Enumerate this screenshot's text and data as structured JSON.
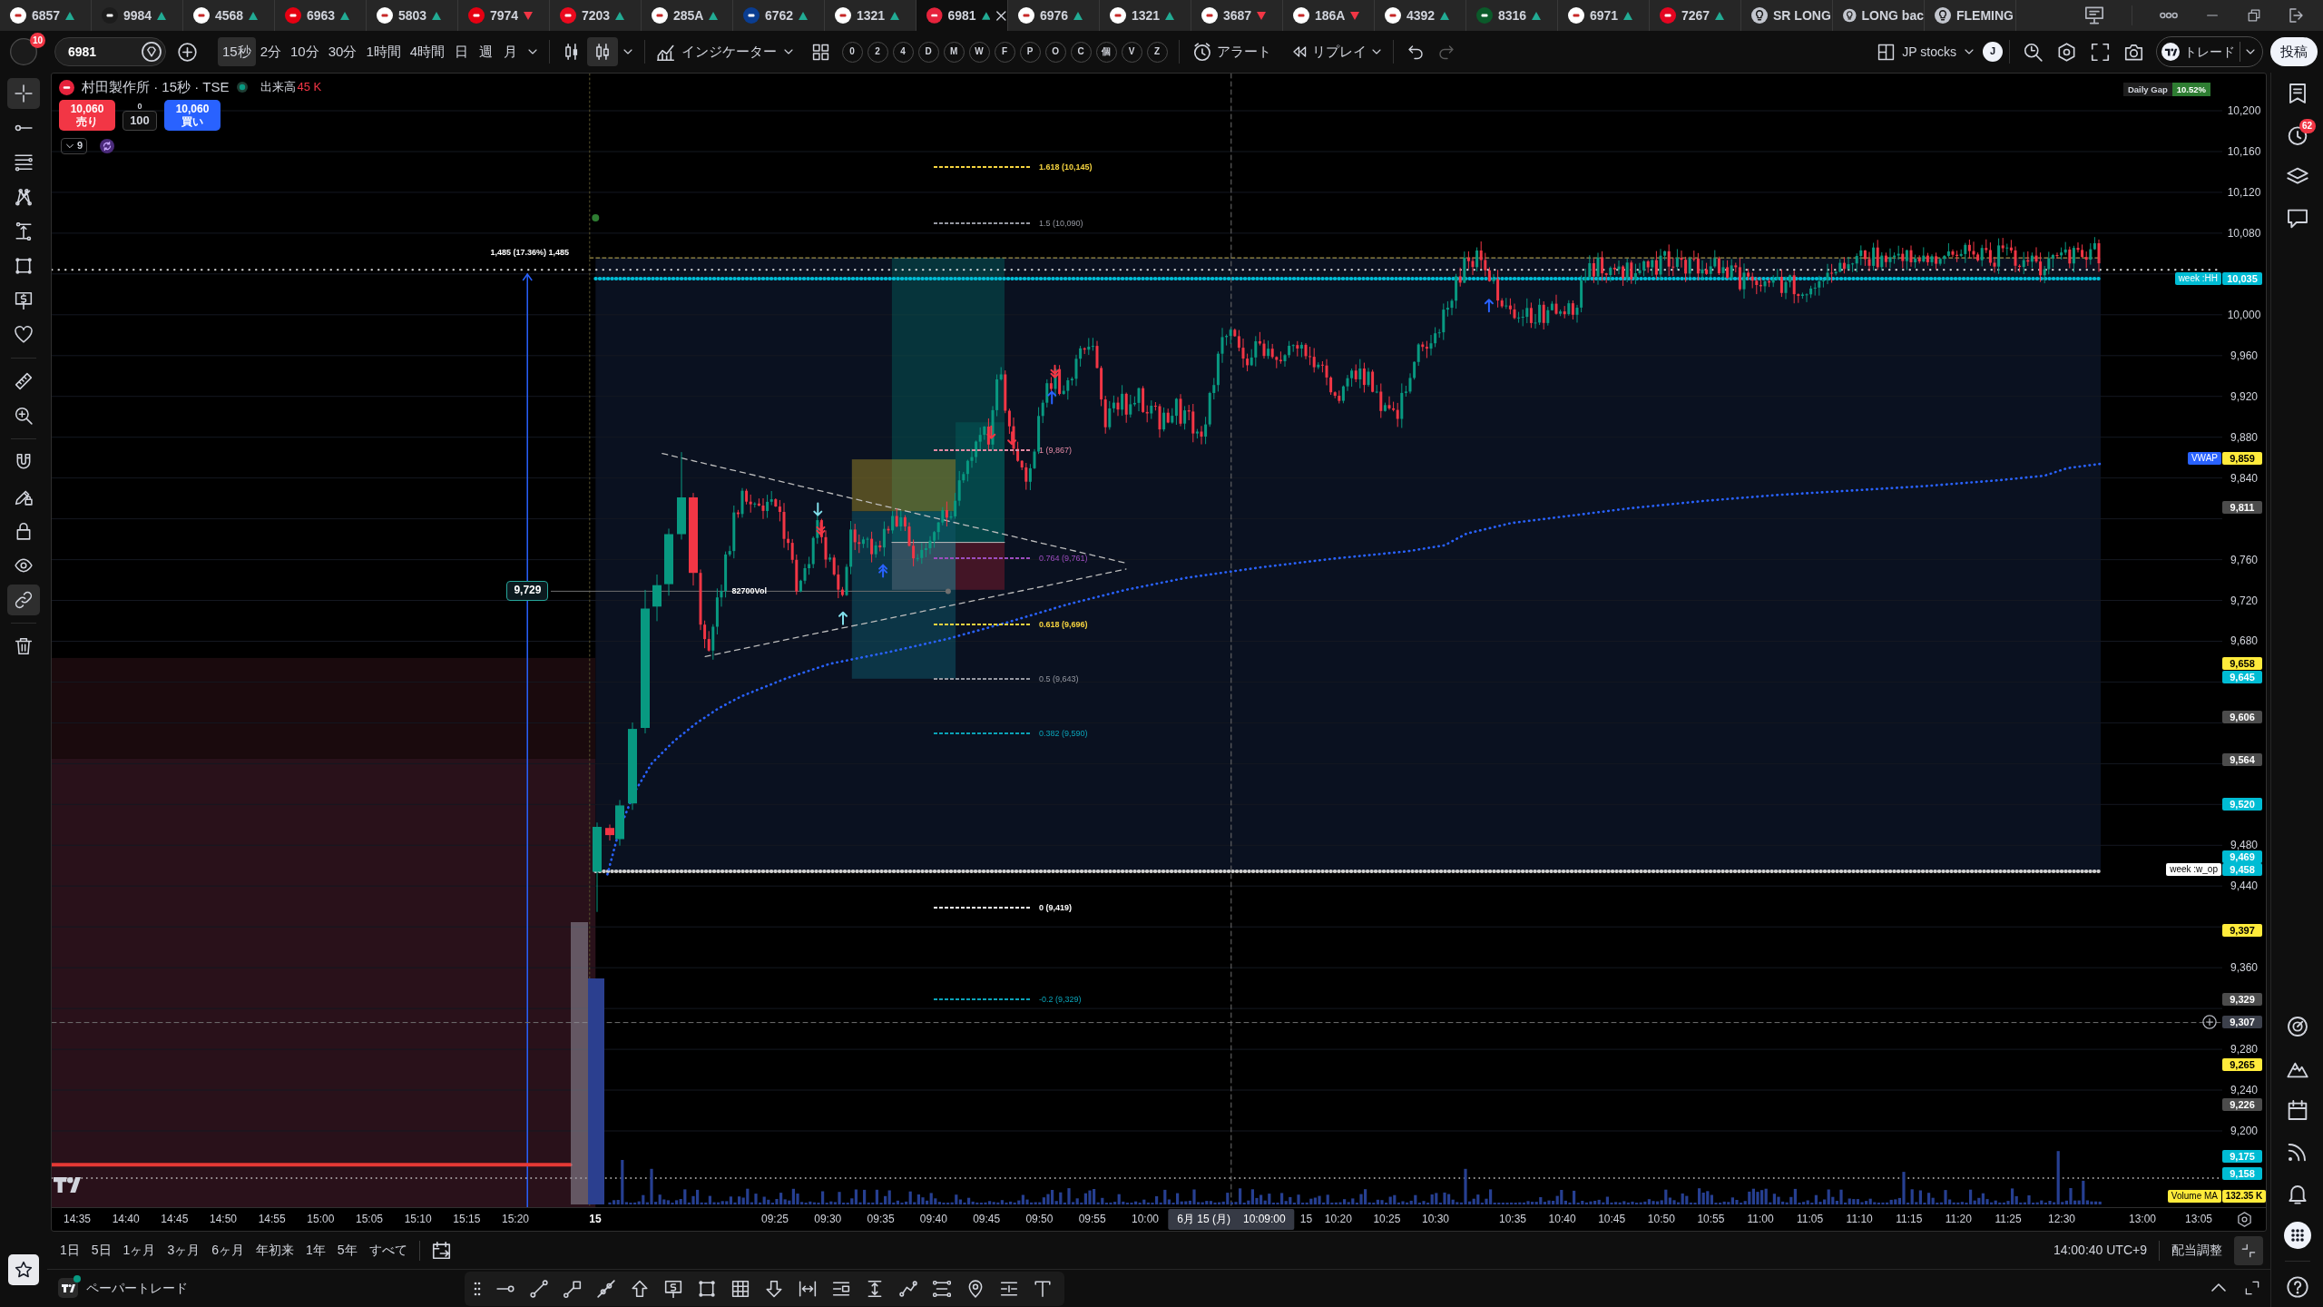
{
  "tabs": [
    {
      "kind": "symbol",
      "label": "6857",
      "color": "#ffffff",
      "rising": true,
      "selected": false
    },
    {
      "kind": "symbol",
      "label": "9984",
      "color": "#1c1c1c",
      "rising": true,
      "selected": false
    },
    {
      "kind": "symbol",
      "label": "4568",
      "color": "#ffffff",
      "rising": true,
      "selected": false
    },
    {
      "kind": "symbol",
      "label": "6963",
      "color": "#e60012",
      "rising": true,
      "selected": false
    },
    {
      "kind": "symbol",
      "label": "5803",
      "color": "#ffffff",
      "rising": true,
      "selected": false
    },
    {
      "kind": "symbol",
      "label": "7974",
      "color": "#e60012",
      "rising": false,
      "selected": false
    },
    {
      "kind": "symbol",
      "label": "7203",
      "color": "#eb0a1e",
      "rising": true,
      "selected": false
    },
    {
      "kind": "symbol",
      "label": "285A",
      "color": "#ffffff",
      "rising": true,
      "selected": false
    },
    {
      "kind": "symbol",
      "label": "6762",
      "color": "#0a3d91",
      "rising": true,
      "selected": false
    },
    {
      "kind": "symbol",
      "label": "1321",
      "color": "#ffffff",
      "rising": true,
      "selected": false
    },
    {
      "kind": "symbol",
      "label": "6981",
      "color": "#e6233c",
      "rising": true,
      "selected": true
    },
    {
      "kind": "symbol",
      "label": "6976",
      "color": "#ffffff",
      "rising": true,
      "selected": false
    },
    {
      "kind": "symbol",
      "label": "1321",
      "color": "#ffffff",
      "rising": true,
      "selected": false
    },
    {
      "kind": "symbol",
      "label": "3687",
      "color": "#ffffff",
      "rising": false,
      "selected": false
    },
    {
      "kind": "symbol",
      "label": "186A",
      "color": "#ffffff",
      "rising": false,
      "selected": false
    },
    {
      "kind": "symbol",
      "label": "4392",
      "color": "#ffffff",
      "rising": true,
      "selected": false
    },
    {
      "kind": "symbol",
      "label": "8316",
      "color": "#0b5a2a",
      "rising": true,
      "selected": false
    },
    {
      "kind": "symbol",
      "label": "6971",
      "color": "#ffffff",
      "rising": true,
      "selected": false
    },
    {
      "kind": "symbol",
      "label": "7267",
      "color": "#e40521",
      "rising": true,
      "selected": false
    },
    {
      "kind": "idea",
      "label": "SR LONG",
      "selected": false
    },
    {
      "kind": "idea",
      "label": "LONG bac",
      "selected": false
    },
    {
      "kind": "idea",
      "label": "FLEMING",
      "selected": false
    }
  ],
  "toolbar": {
    "notification_count": "10",
    "symbol": "6981",
    "intervals": [
      {
        "label": "15秒",
        "selected": true
      },
      {
        "label": "2分",
        "selected": false
      },
      {
        "label": "10分",
        "selected": false
      },
      {
        "label": "30分",
        "selected": false
      },
      {
        "label": "1時間",
        "selected": false
      },
      {
        "label": "4時間",
        "selected": false
      },
      {
        "label": "日",
        "selected": false
      },
      {
        "label": "週",
        "selected": false
      },
      {
        "label": "月",
        "selected": false
      }
    ],
    "chart_styles": [
      {
        "kind": "candles",
        "selected": false
      },
      {
        "kind": "hollow-candles",
        "selected": true
      }
    ],
    "indicators_label": "インジケーター",
    "quick_buttons": [
      "0",
      "2",
      "4",
      "D",
      "M",
      "W",
      "F",
      "P",
      "O",
      "C",
      "個",
      "V",
      "Z"
    ],
    "alert_label": "アラート",
    "replay_label": "リプレイ",
    "history": [
      {
        "kind": "undo",
        "disabled": false
      },
      {
        "kind": "redo",
        "disabled": true
      }
    ],
    "layout_name": "JP stocks",
    "user_initial": "J",
    "trade_label": "トレード",
    "publish_label": "投稿"
  },
  "drawing_tools": [
    {
      "kind": "crosshair",
      "selected": true
    },
    {
      "kind": "line",
      "selected": false
    },
    {
      "kind": "lines",
      "selected": false
    },
    {
      "kind": "pattern",
      "selected": false
    },
    {
      "kind": "beam",
      "selected": false
    },
    {
      "kind": "square",
      "selected": false
    },
    {
      "kind": "label",
      "selected": false
    },
    {
      "kind": "heart",
      "selected": false
    },
    {
      "kind": "ruler",
      "selected": false
    },
    {
      "kind": "zoom",
      "selected": false
    },
    {
      "kind": "magnet",
      "selected": false
    },
    {
      "kind": "pencil-lock",
      "selected": false
    },
    {
      "kind": "lock",
      "selected": false
    },
    {
      "kind": "eye",
      "selected": false
    },
    {
      "kind": "link",
      "selected": true
    },
    {
      "kind": "trash",
      "selected": false
    }
  ],
  "chart": {
    "legend": {
      "title": "村田製作所 · 15秒 · TSE",
      "color": "#e6233c",
      "market_open": true,
      "volume_label": "出来高",
      "volume_value": "45 K"
    },
    "order_panel": {
      "sell_price": "10,060",
      "sell_label": "売り",
      "quantity_hint": "0",
      "quantity": "100",
      "buy_price": "10,060",
      "buy_label": "買い"
    },
    "indicators": {
      "count": "9"
    },
    "daily_gap": {
      "label": "Daily Gap",
      "value": "10.52%"
    },
    "annotations": {
      "measure": "1,485 (17.36%) 1,485",
      "price_marker": "9,729",
      "volume_note": "82700Vol"
    },
    "fib_levels": [
      {
        "label": "1.618 (10,145)",
        "color": "#f5d33f",
        "bold": true
      },
      {
        "label": "1.5 (10,090)",
        "color": "#9598a1",
        "bold": false
      },
      {
        "label": "1 (9,867)",
        "color": "#e48aa4",
        "bold": false
      },
      {
        "label": "0.764 (9,761)",
        "color": "#9c4dbf",
        "bold": false
      },
      {
        "label": "0.618 (9,696)",
        "color": "#f5d33f",
        "bold": true
      },
      {
        "label": "0.5 (9,643)",
        "color": "#9598a1",
        "bold": false
      },
      {
        "label": "0.382 (9,590)",
        "color": "#0aa3b8",
        "bold": false
      },
      {
        "label": "0 (9,419)",
        "color": "#ffffff",
        "bold": true
      },
      {
        "label": "-0.2 (9,329)",
        "color": "#0aa3b8",
        "bold": false
      }
    ],
    "price_axis": {
      "labels": [
        "10,200",
        "10,160",
        "10,120",
        "10,080",
        "10,000",
        "9,960",
        "9,920",
        "9,880",
        "9,840",
        "9,760",
        "9,720",
        "9,680",
        "9,480",
        "9,440",
        "9,360",
        "9,280",
        "9,240",
        "9,200"
      ],
      "tags": [
        {
          "kind": "price",
          "text": "10,035",
          "color": "#00bcd4",
          "caption": {
            "text": "week :HH",
            "color": "#00bcd4"
          }
        },
        {
          "kind": "price",
          "text": "9,859",
          "color": "#ffeb3b",
          "caption": {
            "text": "VWAP",
            "color": "#2962ff"
          }
        },
        {
          "kind": "price",
          "text": "9,811",
          "color": "#4c4c4c"
        },
        {
          "kind": "price",
          "text": "9,658",
          "color": "#ffeb3b"
        },
        {
          "kind": "price",
          "text": "9,645",
          "color": "#00bcd4"
        },
        {
          "kind": "price",
          "text": "9,606",
          "color": "#4c4c4c"
        },
        {
          "kind": "price",
          "text": "9,564",
          "color": "#4c4c4c"
        },
        {
          "kind": "price",
          "text": "9,520",
          "color": "#00bcd4"
        },
        {
          "kind": "price",
          "text": "9,469",
          "color": "#00bcd4"
        },
        {
          "kind": "price",
          "text": "9,458",
          "color": "#00bcd4",
          "caption": {
            "text": "week :w_op",
            "color": "#ffffff"
          }
        },
        {
          "kind": "price",
          "text": "9,397",
          "color": "#ffeb3b"
        },
        {
          "kind": "price",
          "text": "9,329",
          "color": "#4c4c4c"
        },
        {
          "kind": "crosshair",
          "text": "9,307",
          "color": "#3c404b"
        },
        {
          "kind": "price",
          "text": "9,265",
          "color": "#ffeb3b"
        },
        {
          "kind": "price",
          "text": "9,226",
          "color": "#4c4c4c"
        },
        {
          "kind": "price",
          "text": "9,175",
          "color": "#00bcd4"
        },
        {
          "kind": "price",
          "text": "9,158",
          "color": "#00bcd4"
        },
        {
          "kind": "volume",
          "text": "132.35 K",
          "color": "#ffeb3b",
          "caption": {
            "text": "Volume MA",
            "color": "#ffeb3b"
          }
        }
      ]
    },
    "time_axis": [
      {
        "kind": "time",
        "text": "14:35"
      },
      {
        "kind": "time",
        "text": "14:40"
      },
      {
        "kind": "time",
        "text": "14:45"
      },
      {
        "kind": "time",
        "text": "14:50"
      },
      {
        "kind": "time",
        "text": "14:55"
      },
      {
        "kind": "time",
        "text": "15:00"
      },
      {
        "kind": "time",
        "text": "15:05"
      },
      {
        "kind": "time",
        "text": "15:10"
      },
      {
        "kind": "time",
        "text": "15:15"
      },
      {
        "kind": "time",
        "text": "15:20"
      },
      {
        "kind": "day",
        "text": "15"
      },
      {
        "kind": "time",
        "text": "09:25"
      },
      {
        "kind": "time",
        "text": "09:30"
      },
      {
        "kind": "time",
        "text": "09:35"
      },
      {
        "kind": "time",
        "text": "09:40"
      },
      {
        "kind": "time",
        "text": "09:45"
      },
      {
        "kind": "time",
        "text": "09:50"
      },
      {
        "kind": "time",
        "text": "09:55"
      },
      {
        "kind": "time",
        "text": "10:00"
      },
      {
        "kind": "crosshair",
        "date": "6月 15 (月)",
        "text": "10:09:00"
      },
      {
        "kind": "clipped",
        "text": "15"
      },
      {
        "kind": "time",
        "text": "10:20"
      },
      {
        "kind": "time",
        "text": "10:25"
      },
      {
        "kind": "time",
        "text": "10:30"
      },
      {
        "kind": "time",
        "text": "10:35"
      },
      {
        "kind": "time",
        "text": "10:40"
      },
      {
        "kind": "time",
        "text": "10:45"
      },
      {
        "kind": "time",
        "text": "10:50"
      },
      {
        "kind": "time",
        "text": "10:55"
      },
      {
        "kind": "time",
        "text": "11:00"
      },
      {
        "kind": "time",
        "text": "11:05"
      },
      {
        "kind": "time",
        "text": "11:10"
      },
      {
        "kind": "time",
        "text": "11:15"
      },
      {
        "kind": "time",
        "text": "11:20"
      },
      {
        "kind": "time",
        "text": "11:25"
      },
      {
        "kind": "time",
        "text": "12:30"
      },
      {
        "kind": "time",
        "text": "13:00"
      },
      {
        "kind": "time",
        "text": "13:05"
      }
    ]
  },
  "range_bar": {
    "ranges": [
      "1日",
      "5日",
      "1ヶ月",
      "3ヶ月",
      "6ヶ月",
      "年初来",
      "1年",
      "5年",
      "すべて"
    ],
    "clock": "14:00:40 UTC+9",
    "adjustment": "配当調整"
  },
  "bottom_panel": {
    "title": "ペーパートレード",
    "connected": true
  },
  "right_sidebar": {
    "alert_count": "62"
  }
}
